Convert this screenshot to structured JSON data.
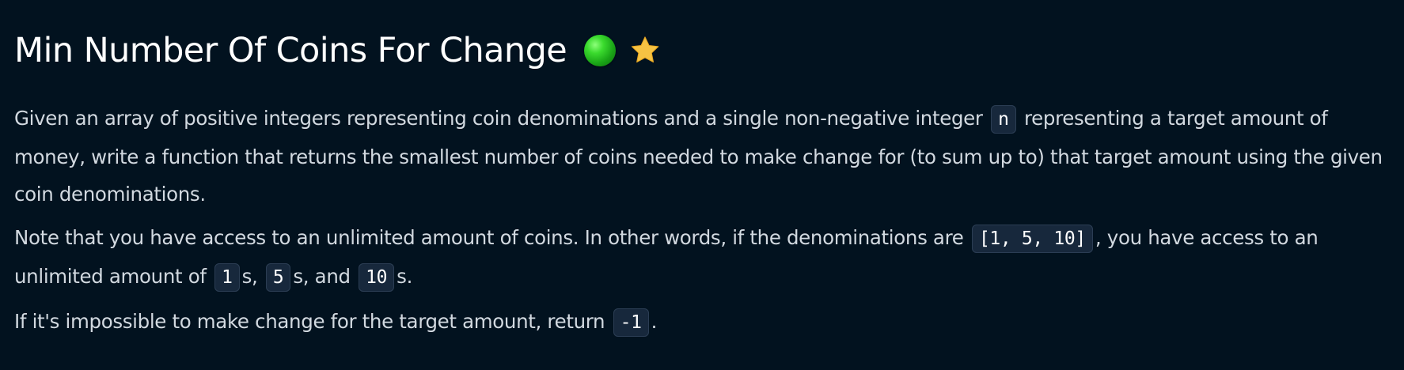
{
  "problem": {
    "title": "Min Number Of Coins For Change",
    "difficulty_icon": "green-circle-icon",
    "favorite_icon": "star-icon",
    "colors": {
      "background": "#02121f",
      "difficulty": "#2cc623",
      "star": "#f6c343",
      "code_background": "#17283c"
    },
    "paragraph1": {
      "text_before": "Given an array of positive integers representing coin denominations and a single non-negative integer ",
      "code": "n",
      "text_after": " representing a target amount of money, write a function that returns the smallest number of coins needed to make change for (to sum up to) that target amount using the given coin denominations."
    },
    "paragraph2": {
      "text1": "Note that you have access to an unlimited amount of coins. In other words, if the denominations are ",
      "code1": "[1, 5, 10]",
      "text2": ", you have access to an unlimited amount of ",
      "code2": "1",
      "text3": "s, ",
      "code3": "5",
      "text4": "s, and ",
      "code4": "10",
      "text5": "s."
    },
    "paragraph3": {
      "text_before": "If it's impossible to make change for the target amount, return ",
      "code": "-1",
      "text_after": "."
    }
  }
}
